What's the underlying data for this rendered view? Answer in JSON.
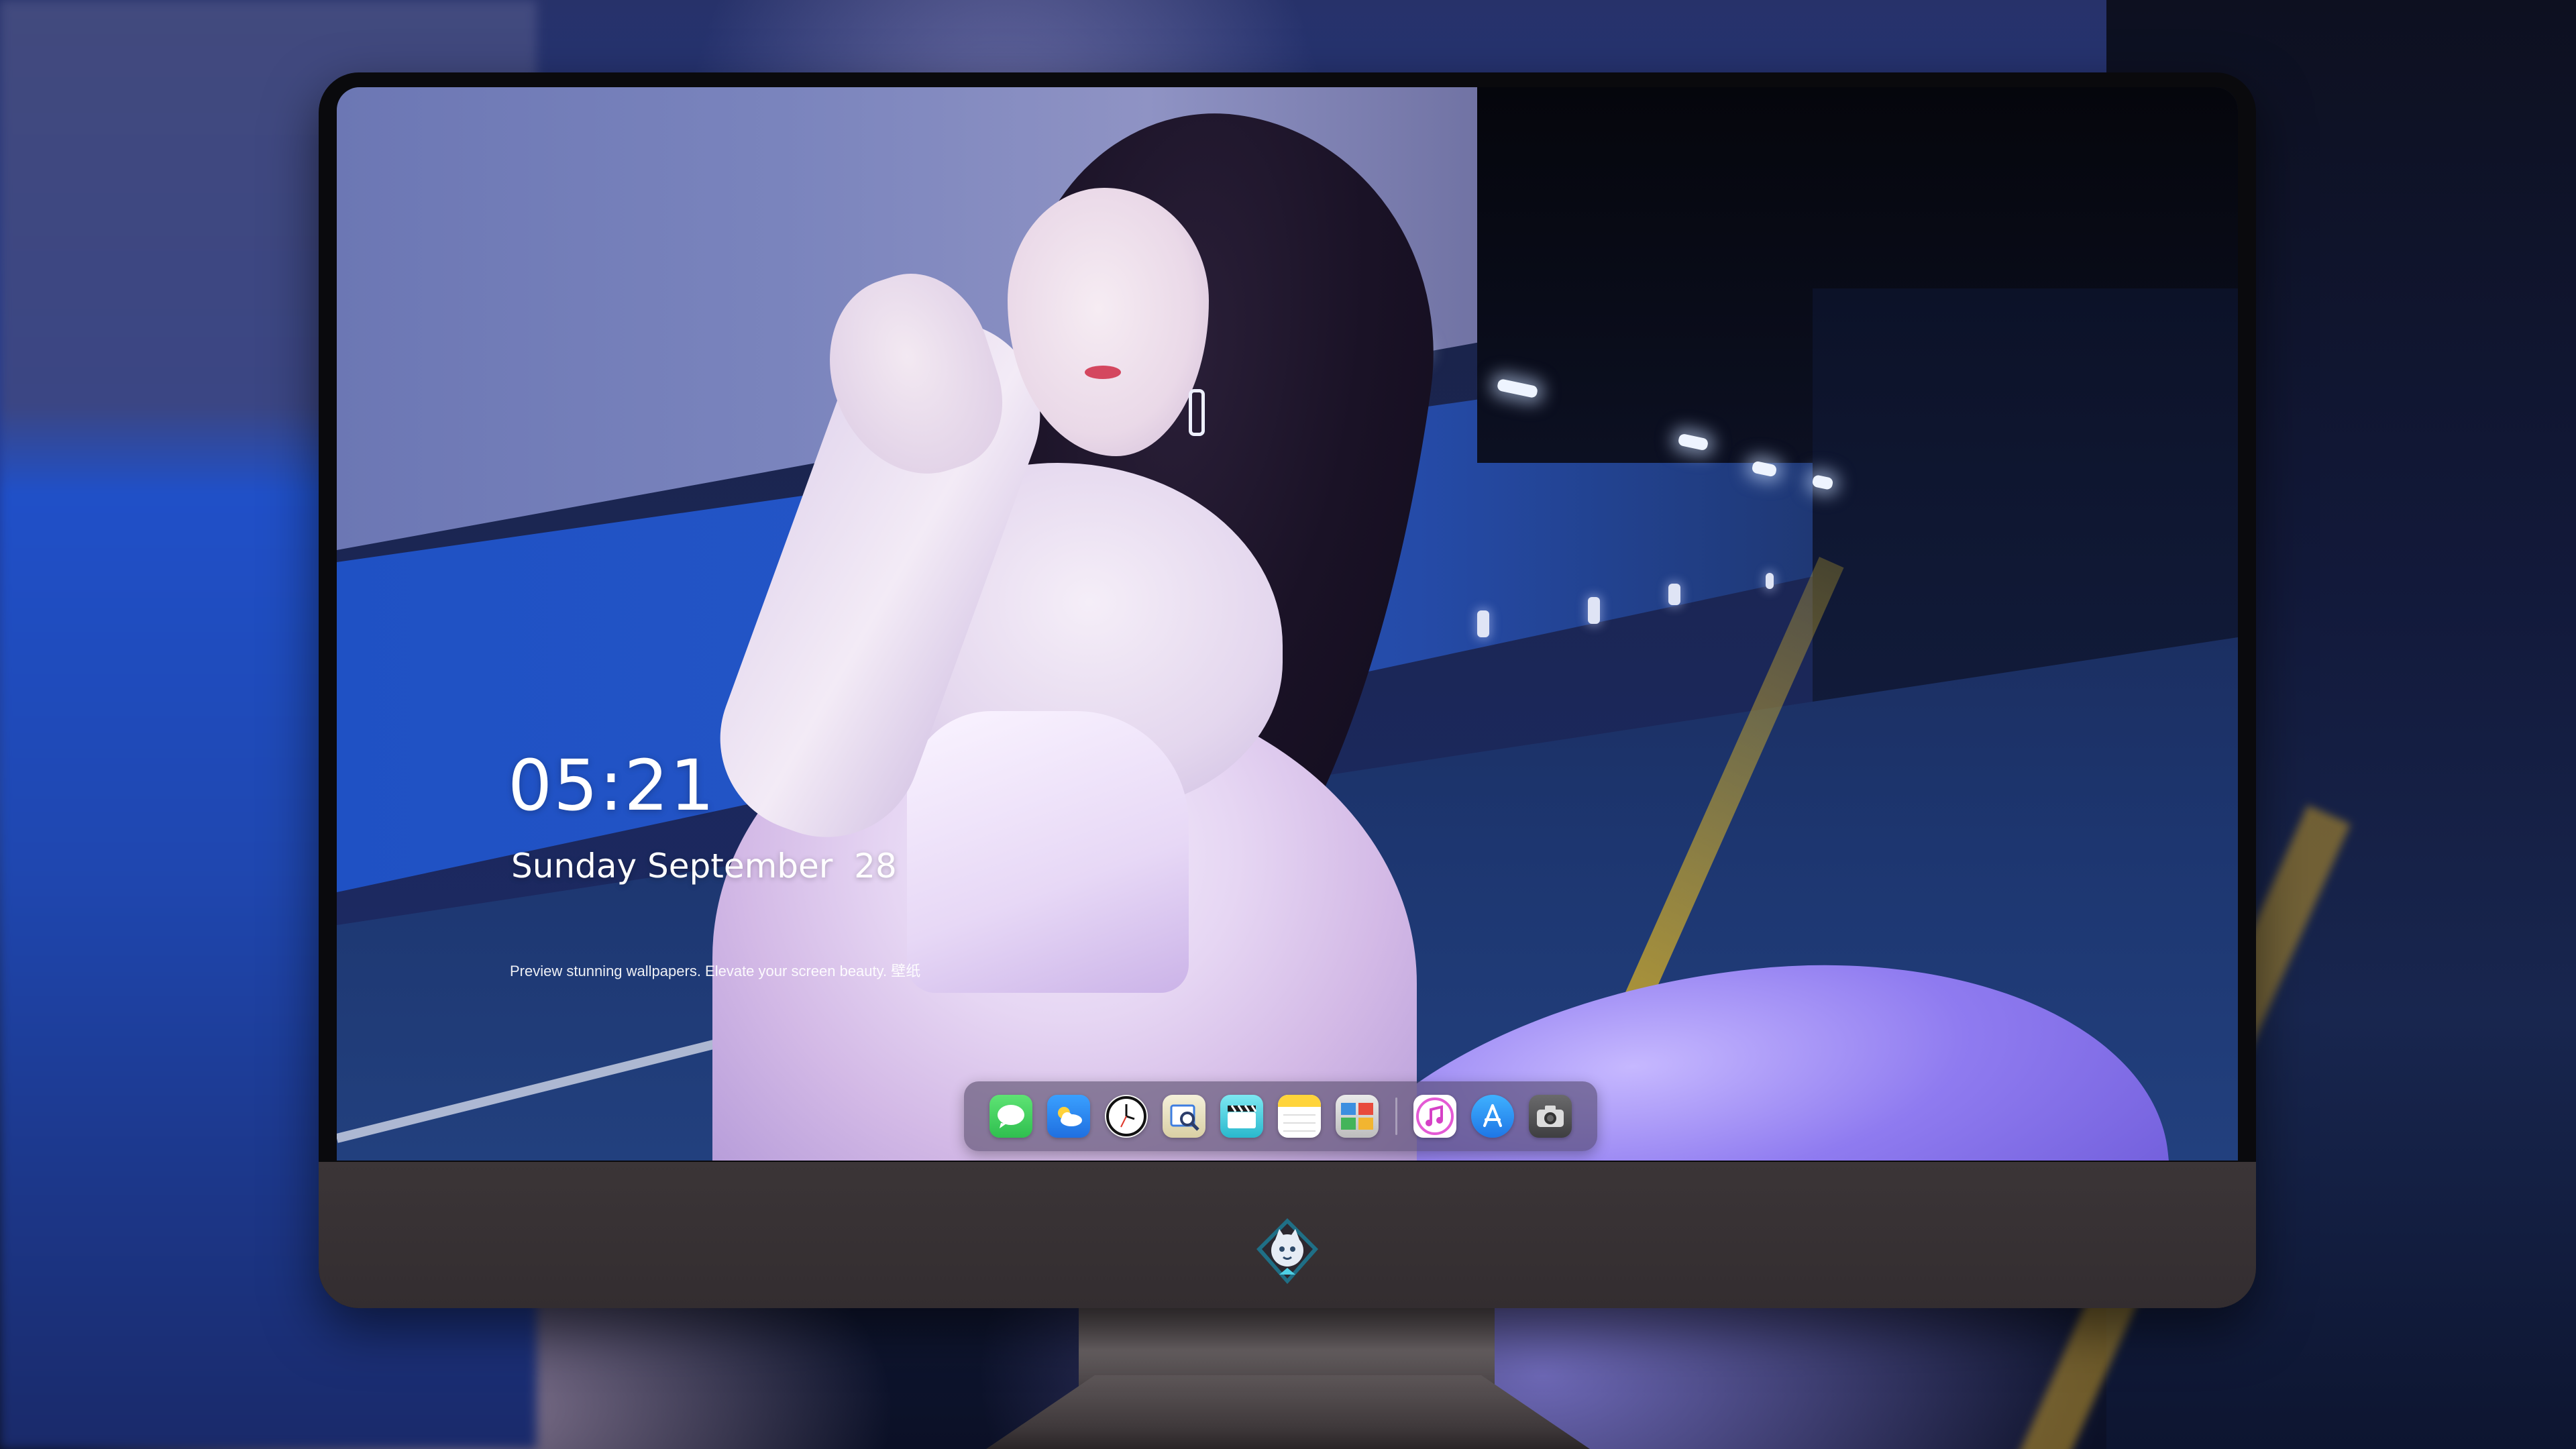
{
  "lock_screen": {
    "time": "05:21",
    "date": "Sunday September  28",
    "tagline": "Preview stunning wallpapers. Elevate your screen beauty. 壁纸"
  },
  "dock": {
    "apps": [
      {
        "name": "Messages",
        "icon": "messages-icon",
        "color": "#34c759"
      },
      {
        "name": "Weather",
        "icon": "weather-icon",
        "color": "#2f8cf0"
      },
      {
        "name": "Clock",
        "icon": "clock-icon",
        "color": "#111111"
      },
      {
        "name": "Preview",
        "icon": "preview-icon",
        "color": "#e9e3c8"
      },
      {
        "name": "Clips",
        "icon": "clips-icon",
        "color": "#2ec6d6"
      },
      {
        "name": "Notes",
        "icon": "notes-icon",
        "color": "#ffd43b"
      },
      {
        "name": "Photo Booth",
        "icon": "photo-booth-icon",
        "color": "#3c8f4a"
      }
    ],
    "pinned_apps": [
      {
        "name": "iTunes",
        "icon": "music-icon",
        "color": "#e45ad5"
      },
      {
        "name": "App Store",
        "icon": "app-store-icon",
        "color": "#1e8bf0"
      },
      {
        "name": "Screenshot",
        "icon": "camera-icon",
        "color": "#555557"
      }
    ]
  },
  "monitor": {
    "logo": "mascot-logo-icon"
  }
}
